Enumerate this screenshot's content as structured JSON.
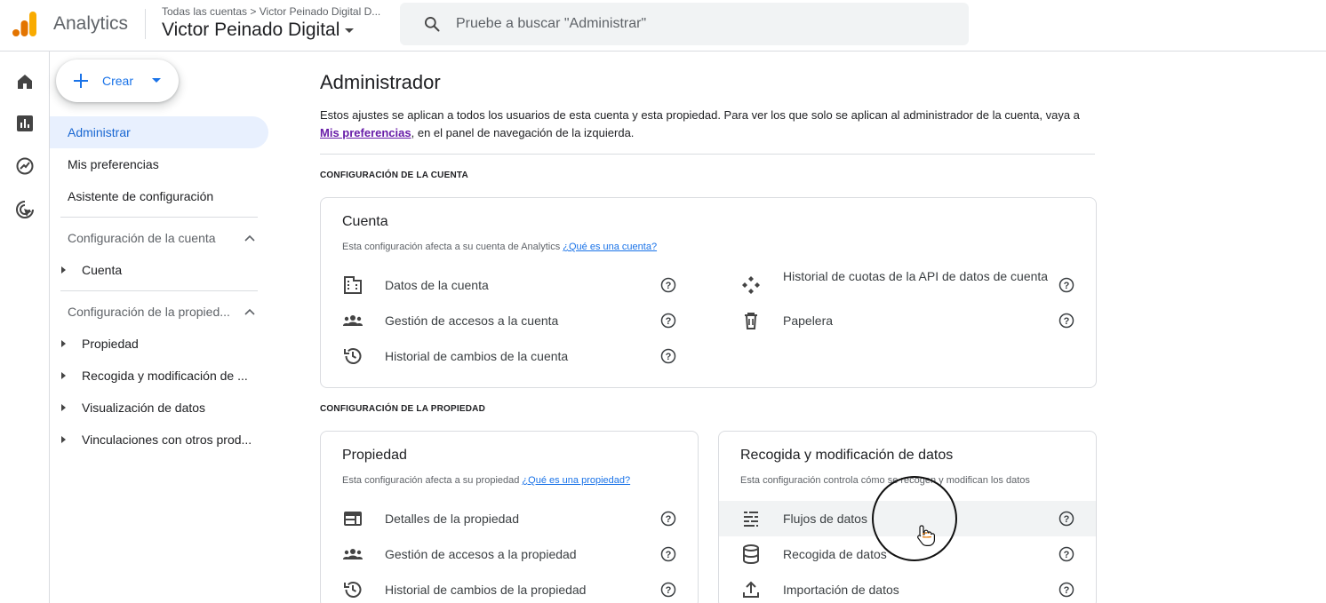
{
  "header": {
    "brand": "Analytics",
    "breadcrumb": "Todas las cuentas > Victor Peinado Digital D...",
    "account_name": "Victor Peinado Digital",
    "search_placeholder": "Pruebe a buscar \"Administrar\"",
    "logo_colors": [
      "#f9ab00",
      "#e37400",
      "#e37400"
    ]
  },
  "rail": {
    "icons": [
      "home-icon",
      "reports-icon",
      "explore-icon",
      "advertising-icon"
    ]
  },
  "nav": {
    "create_label": "Crear",
    "items": [
      "Administrar",
      "Mis preferencias",
      "Asistente de configuración"
    ],
    "account_section": "Configuración de la cuenta",
    "account_sub": [
      "Cuenta"
    ],
    "property_section": "Configuración de la propied...",
    "property_sub": [
      "Propiedad",
      "Recogida y modificación de ...",
      "Visualización de datos",
      "Vinculaciones con otros prod..."
    ]
  },
  "main": {
    "title": "Administrador",
    "intro_1": "Estos ajustes se aplican a todos los usuarios de esta cuenta y esta propiedad. Para ver los que solo se aplican al administrador de la cuenta, vaya a ",
    "intro_link": "Mis preferencias",
    "intro_2": ", en el panel de navegación de la izquierda.",
    "account_heading": "CONFIGURACIÓN DE LA CUENTA",
    "property_heading": "CONFIGURACIÓN DE LA PROPIEDAD",
    "account_card": {
      "title": "Cuenta",
      "desc": "Esta configuración afecta a su cuenta de Analytics ",
      "desc_link": "¿Qué es una cuenta?",
      "left_rows": [
        "Datos de la cuenta",
        "Gestión de accesos a la cuenta",
        "Historial de cambios de la cuenta"
      ],
      "right_rows": [
        "Historial de cuotas de la API de datos de cuenta",
        "Papelera"
      ]
    },
    "property_card": {
      "title": "Propiedad",
      "desc": "Esta configuración afecta a su propiedad ",
      "desc_link": "¿Qué es una propiedad?",
      "rows": [
        "Detalles de la propiedad",
        "Gestión de accesos a la propiedad",
        "Historial de cambios de la propiedad"
      ]
    },
    "data_card": {
      "title": "Recogida y modificación de datos",
      "desc": "Esta configuración controla cómo se recogen y modifican los datos",
      "rows": [
        "Flujos de datos",
        "Recogida de datos",
        "Importación de datos"
      ]
    }
  }
}
